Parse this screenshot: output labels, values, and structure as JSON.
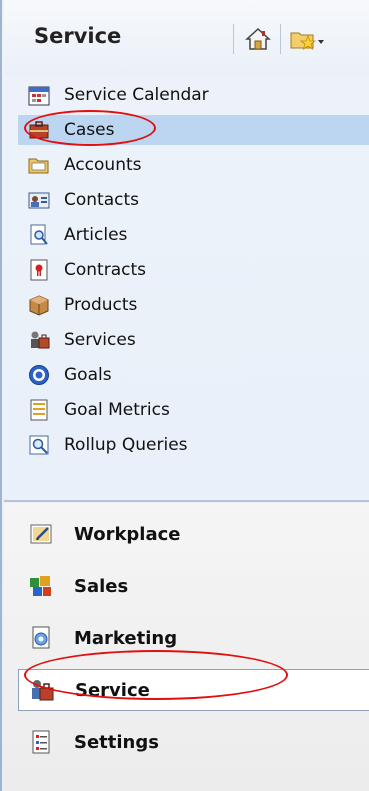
{
  "header": {
    "title": "Service",
    "home_icon": "home-icon",
    "favorites_icon": "favorites-folder-icon"
  },
  "sub_areas": [
    {
      "label": "Service Calendar",
      "icon": "calendar-icon"
    },
    {
      "label": "Cases",
      "icon": "case-icon",
      "selected": true
    },
    {
      "label": "Accounts",
      "icon": "accounts-icon"
    },
    {
      "label": "Contacts",
      "icon": "contact-card-icon"
    },
    {
      "label": "Articles",
      "icon": "article-search-icon"
    },
    {
      "label": "Contracts",
      "icon": "contract-icon"
    },
    {
      "label": "Products",
      "icon": "product-box-icon"
    },
    {
      "label": "Services",
      "icon": "services-icon"
    },
    {
      "label": "Goals",
      "icon": "goal-target-icon"
    },
    {
      "label": "Goal Metrics",
      "icon": "goal-metrics-icon"
    },
    {
      "label": "Rollup Queries",
      "icon": "rollup-query-icon"
    }
  ],
  "areas": [
    {
      "label": "Workplace",
      "icon": "workplace-icon"
    },
    {
      "label": "Sales",
      "icon": "sales-icon"
    },
    {
      "label": "Marketing",
      "icon": "marketing-icon"
    },
    {
      "label": "Service",
      "icon": "service-icon",
      "active": true
    },
    {
      "label": "Settings",
      "icon": "settings-icon"
    }
  ],
  "colors": {
    "selection": "#bcd6f2",
    "highlight_ring": "#e01010"
  }
}
